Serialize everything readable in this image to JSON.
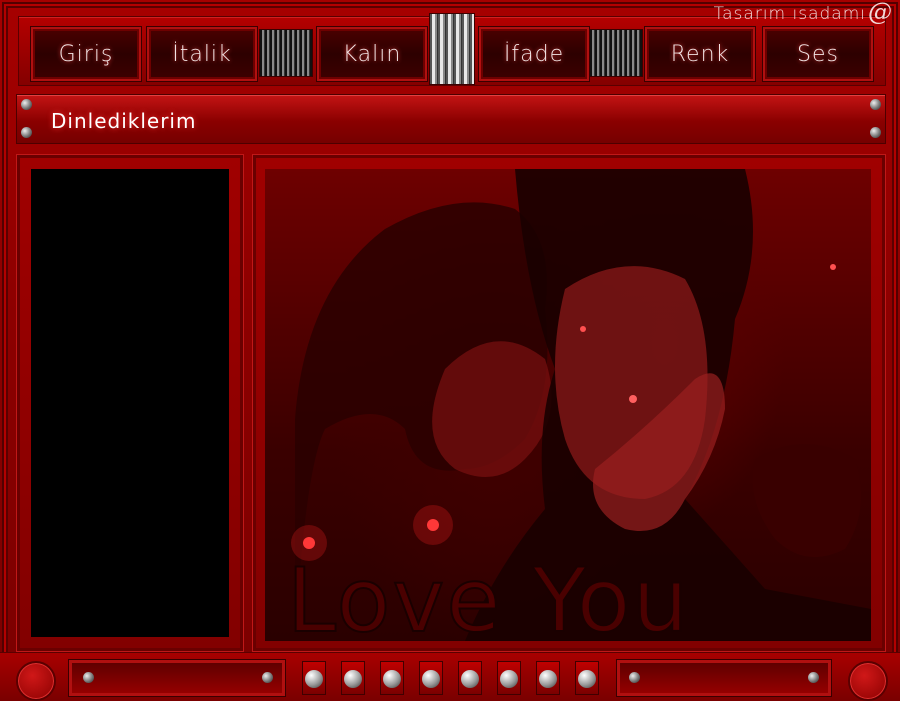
{
  "brand": {
    "text": "Tasarım ısadamı"
  },
  "nav": [
    {
      "label": "Giriş"
    },
    {
      "label": "İtalik"
    },
    {
      "label": "Kalın"
    },
    {
      "label": "İfade"
    },
    {
      "label": "Renk"
    },
    {
      "label": "Ses"
    }
  ],
  "subbar": {
    "title": "Dinlediklerim"
  },
  "image": {
    "caption": "Love You"
  },
  "colors": {
    "frame": "#8a0000",
    "accent": "#c41414",
    "panel_bg": "#000000"
  },
  "icons": [
    "at-icon",
    "rivet",
    "grille",
    "round-button",
    "knob"
  ]
}
